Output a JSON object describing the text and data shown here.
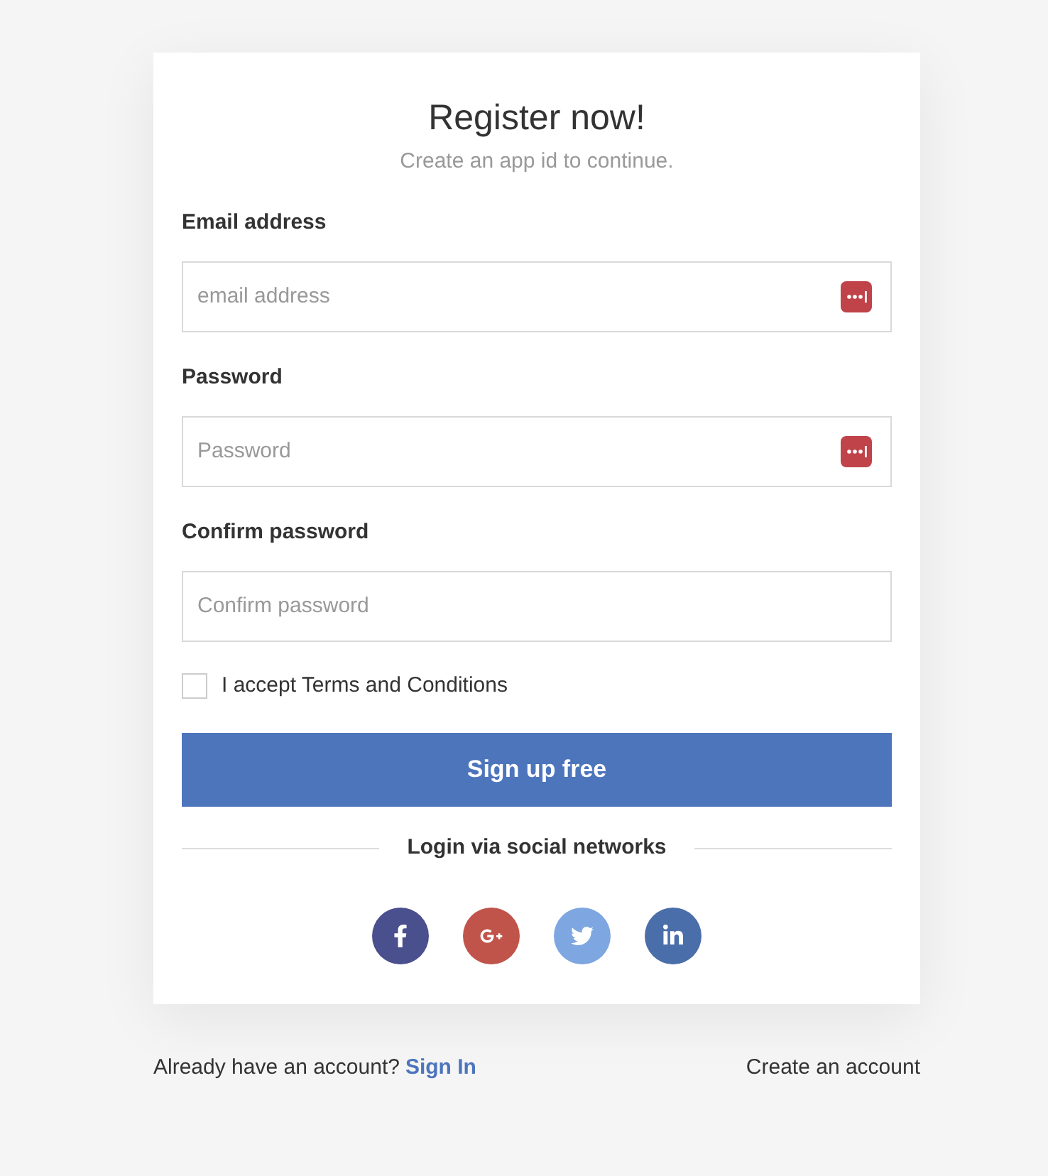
{
  "title": "Register now!",
  "subtitle": "Create an app id to continue.",
  "fields": [
    {
      "label": "Email address",
      "placeholder": "email address",
      "manager_icon": true
    },
    {
      "label": "Password",
      "placeholder": "Password",
      "manager_icon": true
    },
    {
      "label": "Confirm password",
      "placeholder": "Confirm password",
      "manager_icon": false
    }
  ],
  "terms": {
    "label": "I accept Terms and Conditions",
    "checked": false
  },
  "submit": "Sign up free",
  "social_heading": "Login via social networks",
  "social": [
    {
      "kind": "facebook",
      "color": "#4a4f8e"
    },
    {
      "kind": "google",
      "color": "#c0544a"
    },
    {
      "kind": "twitter",
      "color": "#7ea6e0"
    },
    {
      "kind": "linkedin",
      "color": "#4a6ea9"
    }
  ],
  "footer": {
    "prompt": "Already have an account?",
    "link": "Sign In",
    "create": "Create an account"
  }
}
